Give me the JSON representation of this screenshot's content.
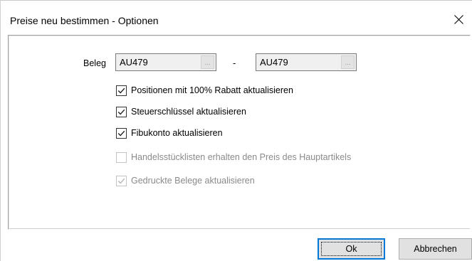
{
  "window": {
    "title": "Preise neu bestimmen - Optionen",
    "close_glyph": "close-icon"
  },
  "beleg": {
    "label": "Beleg",
    "from_value": "AU479",
    "to_value": "AU479",
    "separator": "-",
    "browse_label": "..."
  },
  "options": [
    {
      "label": "Positionen mit 100% Rabatt aktualisieren",
      "checked": true,
      "enabled": true
    },
    {
      "label": "Steuerschlüssel aktualisieren",
      "checked": true,
      "enabled": true
    },
    {
      "label": "Fibukonto aktualisieren",
      "checked": true,
      "enabled": true
    },
    {
      "label": "Handelsstücklisten erhalten den Preis des Hauptartikels",
      "checked": false,
      "enabled": false
    },
    {
      "label": "Gedruckte Belege aktualisieren",
      "checked": true,
      "enabled": false
    }
  ],
  "buttons": {
    "ok": "Ok",
    "cancel": "Abbrechen"
  },
  "colors": {
    "focus_border": "#0078d7",
    "button_bg": "#e1e1e1",
    "field_bg": "#f0f0f0"
  }
}
